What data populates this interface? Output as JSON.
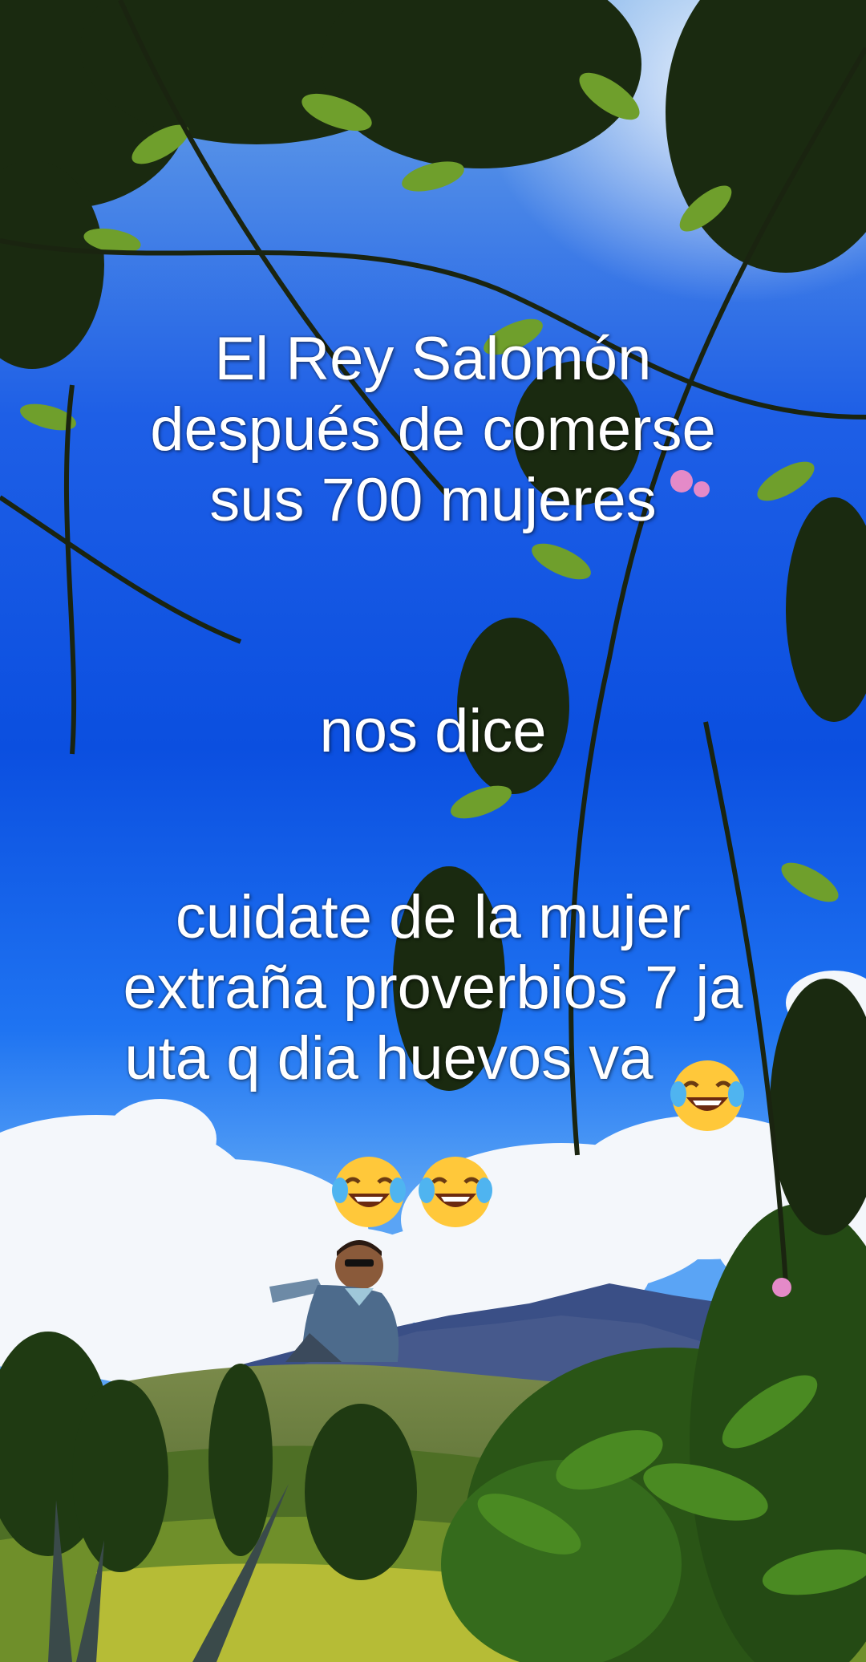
{
  "caption": {
    "block1": [
      "El Rey  Salomón",
      "después de comerse",
      "sus 700 mujeres"
    ],
    "block2": [
      "nos dice"
    ],
    "block3": [
      "cuidate de la mujer",
      "extraña proverbios 7 ja",
      "uta q dia huevos va"
    ]
  },
  "emoji_icons": [
    "face-with-tears-of-joy",
    "face-with-tears-of-joy",
    "face-with-tears-of-joy"
  ],
  "colors": {
    "sky_top": "#0a3fc8",
    "sky_mid": "#1e6cf0",
    "sky_low": "#5aa4f5",
    "cloud": "#f4f7fb",
    "mountain": "#3a4f86",
    "foliage_dark": "#1c2d12",
    "foliage_light": "#8fbf3a",
    "text": "#ffffff",
    "emoji_face": "#ffc83a"
  }
}
